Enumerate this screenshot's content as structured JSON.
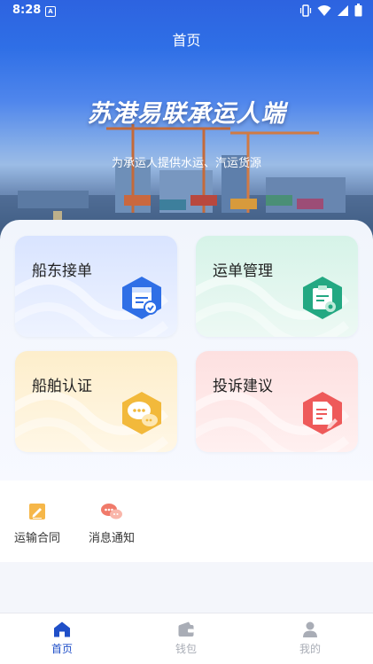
{
  "status_bar": {
    "time": "8:28",
    "notification_icon": "A"
  },
  "header": {
    "title": "首页"
  },
  "hero": {
    "title": "苏港易联承运人端",
    "subtitle": "为承运人提供水运、汽运货源"
  },
  "cards": [
    {
      "label": "船东接单",
      "icon": "calendar-check-icon",
      "color": "#2f6fe6"
    },
    {
      "label": "运单管理",
      "icon": "clipboard-icon",
      "color": "#23a882"
    },
    {
      "label": "船舶认证",
      "icon": "chat-bubbles-icon",
      "color": "#f2b93b"
    },
    {
      "label": "投诉建议",
      "icon": "document-edit-icon",
      "color": "#ee5a5a"
    }
  ],
  "quick_actions": [
    {
      "label": "运输合同",
      "icon": "pencil-note-icon"
    },
    {
      "label": "消息通知",
      "icon": "message-icon"
    }
  ],
  "tabs": [
    {
      "label": "首页",
      "icon": "home-icon",
      "active": true
    },
    {
      "label": "钱包",
      "icon": "wallet-icon",
      "active": false
    },
    {
      "label": "我的",
      "icon": "user-icon",
      "active": false
    }
  ],
  "colors": {
    "primary": "#2d63e0",
    "tab_active": "#1f4fc8",
    "tab_inactive": "#a9adb6"
  }
}
